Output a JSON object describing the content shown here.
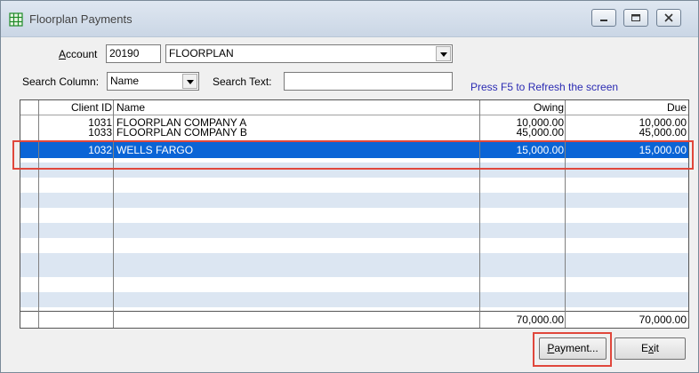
{
  "window": {
    "title": "Floorplan Payments"
  },
  "account": {
    "label_u": "A",
    "label_rest": "ccount",
    "number": "20190",
    "name": "FLOORPLAN"
  },
  "search": {
    "column_label": "Search Column:",
    "column_value": "Name",
    "text_label": "Search Text:",
    "text_value": ""
  },
  "hint": "Press F5 to Refresh the screen",
  "table": {
    "headers": [
      "Client ID",
      "Name",
      "Owing",
      "Due"
    ],
    "rows": [
      {
        "client_id": "1031",
        "name": "FLOORPLAN COMPANY A",
        "owing": "10,000.00",
        "due": "10,000.00"
      },
      {
        "client_id": "1033",
        "name": "FLOORPLAN COMPANY B",
        "owing": "45,000.00",
        "due": "45,000.00"
      },
      {
        "client_id": "1032",
        "name": "WELLS FARGO",
        "owing": "15,000.00",
        "due": "15,000.00"
      }
    ],
    "totals": {
      "owing": "70,000.00",
      "due": "70,000.00"
    },
    "selected_index": 2
  },
  "buttons": {
    "payment": {
      "u": "P",
      "rest": "ayment..."
    },
    "exit": {
      "pre": "E",
      "u": "x",
      "rest": "it"
    }
  },
  "colors": {
    "selection": "#0a64d6",
    "stripe": "#dce6f2",
    "annotation": "#e0473c"
  }
}
